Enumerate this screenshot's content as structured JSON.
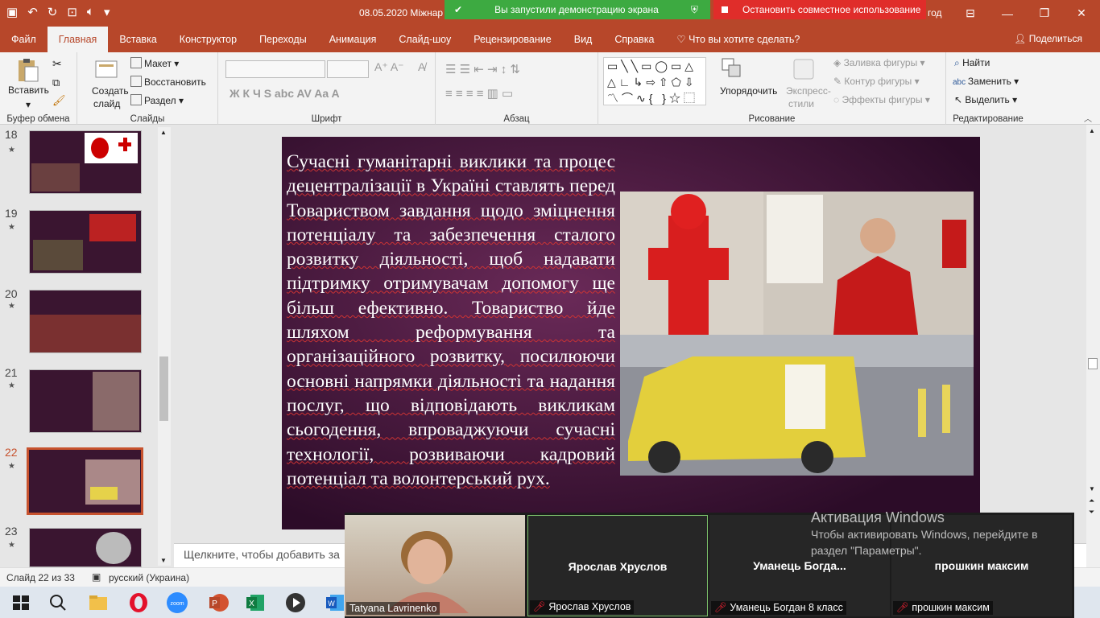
{
  "window": {
    "title": "08.05.2020 Міжнар",
    "title_tail": "год"
  },
  "share": {
    "green_text": "Вы запустили демонстрацию экрана",
    "red_text": "Остановить совместное использование"
  },
  "tabs": [
    "Файл",
    "Главная",
    "Вставка",
    "Конструктор",
    "Переходы",
    "Анимация",
    "Слайд-шоу",
    "Рецензирование",
    "Вид",
    "Справка",
    "Что вы хотите сделать?"
  ],
  "share_label": "Поделиться",
  "ribbon": {
    "clipboard": {
      "paste": "Вставить",
      "label": "Буфер обмена"
    },
    "slides": {
      "new_slide_1": "Создать",
      "new_slide_2": "слайд",
      "layout": "Макет",
      "reset": "Восстановить",
      "section": "Раздел",
      "label": "Слайды"
    },
    "font": {
      "label": "Шрифт"
    },
    "paragraph": {
      "label": "Абзац"
    },
    "drawing": {
      "arrange": "Упорядочить",
      "styles_1": "Экспресс-",
      "styles_2": "стили",
      "fill": "Заливка фигуры",
      "outline": "Контур фигуры",
      "effects": "Эффекты фигуры",
      "label": "Рисование"
    },
    "editing": {
      "find": "Найти",
      "replace": "Заменить",
      "select": "Выделить",
      "label": "Редактирование"
    }
  },
  "thumbnails": [
    {
      "num": "18",
      "star": "★"
    },
    {
      "num": "19",
      "star": "★"
    },
    {
      "num": "20",
      "star": "★"
    },
    {
      "num": "21",
      "star": "★"
    },
    {
      "num": "22",
      "star": "★"
    },
    {
      "num": "23",
      "star": "★"
    }
  ],
  "slide": {
    "text": "Сучасні гуманітарні виклики та процес децентралізації в Україні ставлять перед Товариством завдання щодо зміцнення потенціалу та забезпечення сталого розвитку діяльності, щоб надавати підтримку отримувачам допомогу ще більш ефективно. Товариство йде шляхом реформування та організаційного розвитку, посилюючи основні напрямки діяльності та надання послуг, що відповідають викликам сьогодення, впроваджуючи сучасні технології, розвиваючи кадровий потенціал та волонтерський рух."
  },
  "notes_placeholder": "Щелкните, чтобы добавить за",
  "status": {
    "slide_counter": "Слайд 22 из 33",
    "language": "русский (Украина)"
  },
  "zoom": {
    "participants": [
      {
        "name": "Tatyana Lavrinenko",
        "big": ""
      },
      {
        "name": "Ярослав Хрусло в",
        "big": "Ярослав Хруслов"
      },
      {
        "name": "Уманець Богдан 8 класс",
        "big": "Уманець  Богда..."
      },
      {
        "name": "прошкин максим",
        "big": "прошкин максим"
      }
    ]
  },
  "activation": {
    "title": "Активация Windows",
    "line": "Чтобы активировать Windows, перейдите в раздел \"Параметры\"."
  }
}
